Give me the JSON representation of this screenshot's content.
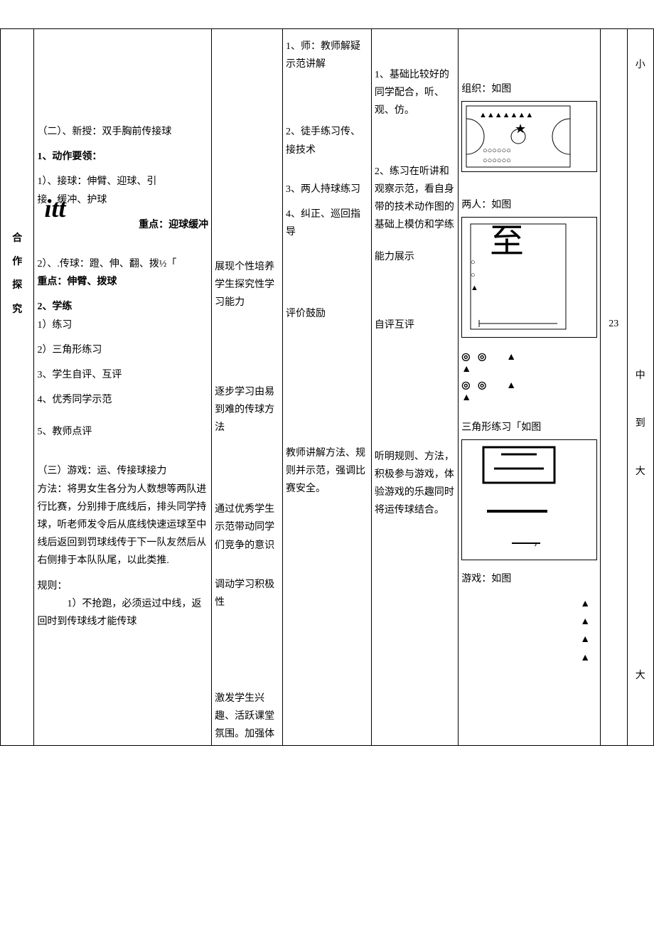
{
  "side": {
    "c1": "合",
    "c2": "作",
    "c3": "探",
    "c4": "究"
  },
  "content": {
    "sec2_title": "（二）、新授：双手胸前传接球",
    "point1_title": "1、动作要领：",
    "point1_1": "1）、接球：伸臂、迎球、引",
    "point1_1b": "接、缓冲、护球",
    "point1_key": "重点：迎球缓冲",
    "point1_2": "2）、.传球：蹬、伸、翻、拨½「",
    "point1_2_key": "重点：伸臂、拨球",
    "point2_title": "2、学练",
    "point2_1": "1）练习",
    "point2_2": "2）三角形练习",
    "point3": "3、学生自评、互评",
    "point4": "4、优秀同学示范",
    "point5": "5、教师点评",
    "sec3_title": "（三）游戏：运、传接球接力",
    "sec3_method": "方法：将男女生各分为人数想等两队进行比赛，分别排于底线后，排头同学持球，听老师发令后从底线快速运球至中线后返回到罚球线传于下一队友然后从右侧排于本队队尾，以此类推.",
    "sec3_rules_title": "规则：",
    "sec3_rule1": "1）不抢跑，必须运过中线，返回时到传球线才能传球"
  },
  "intent": {
    "i1": "展现个性培养学生探究性学习能力",
    "i2": "逐步学习由易到难的传球方法",
    "i3": "通过优秀学生示范带动同学们竞争的意识",
    "i4": "调动学习积极性",
    "i5": "激发学生兴趣、活跃课堂氛围。加强体"
  },
  "teacher": {
    "t1": "1、师：教师解疑示范讲解",
    "t2": "2、徒手练习传、接技术",
    "t3": "3、两人持球练习",
    "t4": "4、纠正、巡回指导",
    "t5": "评价鼓励",
    "t6": "教师讲解方法、规则并示范，强调比赛安全。"
  },
  "student": {
    "s1": "1、基础比较好的同学配合，听、观、仿。",
    "s2": "2、练习在听讲和观察示范，看自身带的技术动作图的基础上模仿和学练",
    "s3": "能力展示",
    "s4": "自评互评",
    "s5": "听明规则、方法，积极参与游戏，体验游戏的乐趣同时将运传球结合。"
  },
  "diagram": {
    "d1_label": "组织：如图",
    "d2_label": "两人：如图",
    "d3_label": "三角形练习「如图",
    "d4_label": "游戏：如图"
  },
  "time": {
    "num": "23"
  },
  "intensity": {
    "r1": "小",
    "r2": "中",
    "r3": "到",
    "r4": "大",
    "r5": "大"
  }
}
